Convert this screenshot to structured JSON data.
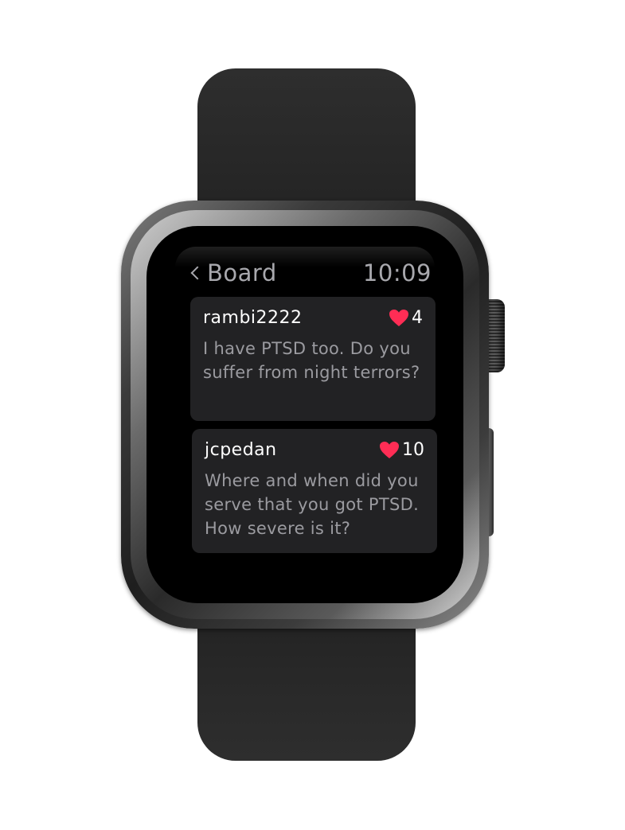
{
  "screen": {
    "header": {
      "back_label": "Board",
      "time": "10:09"
    },
    "posts": [
      {
        "username": "rambi2222",
        "likes": "4",
        "message": "I have PTSD too. Do you suffer from night terrors?"
      },
      {
        "username": "jcpedan",
        "likes": "10",
        "message": "Where and when did you serve that you got PTSD. How severe is it?"
      }
    ]
  },
  "colors": {
    "card_background": "#222224",
    "heart": "#ff2d55",
    "secondary_text": "#9b9ba0",
    "header_text": "#a8a8ad"
  },
  "icons": [
    "chevron-left-icon",
    "heart-icon"
  ]
}
